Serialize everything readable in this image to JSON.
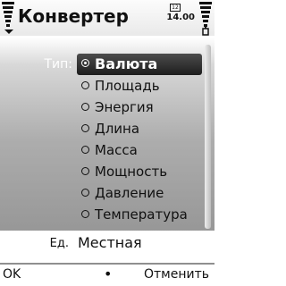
{
  "header": {
    "title": "Конвертер",
    "battery_indicator": "12",
    "clock": "14.00",
    "signal_icon": "signal-strength-icon",
    "battery_icon": "battery-level-icon"
  },
  "form": {
    "type_label": "Тип:",
    "type_options": [
      {
        "label": "Валюта",
        "selected": true
      },
      {
        "label": "Площадь",
        "selected": false
      },
      {
        "label": "Энергия",
        "selected": false
      },
      {
        "label": "Длина",
        "selected": false
      },
      {
        "label": "Масса",
        "selected": false
      },
      {
        "label": "Мощность",
        "selected": false
      },
      {
        "label": "Давление",
        "selected": false
      },
      {
        "label": "Температура",
        "selected": false
      }
    ],
    "unit_label": "Ед.",
    "unit_value": "Местная"
  },
  "softkeys": {
    "left": "OK",
    "middle": "•",
    "right": "Отменить"
  },
  "colors": {
    "selection": "#2a2a2a",
    "panel_top": "#d8d8d8",
    "panel_bottom": "#8f8f8f"
  }
}
